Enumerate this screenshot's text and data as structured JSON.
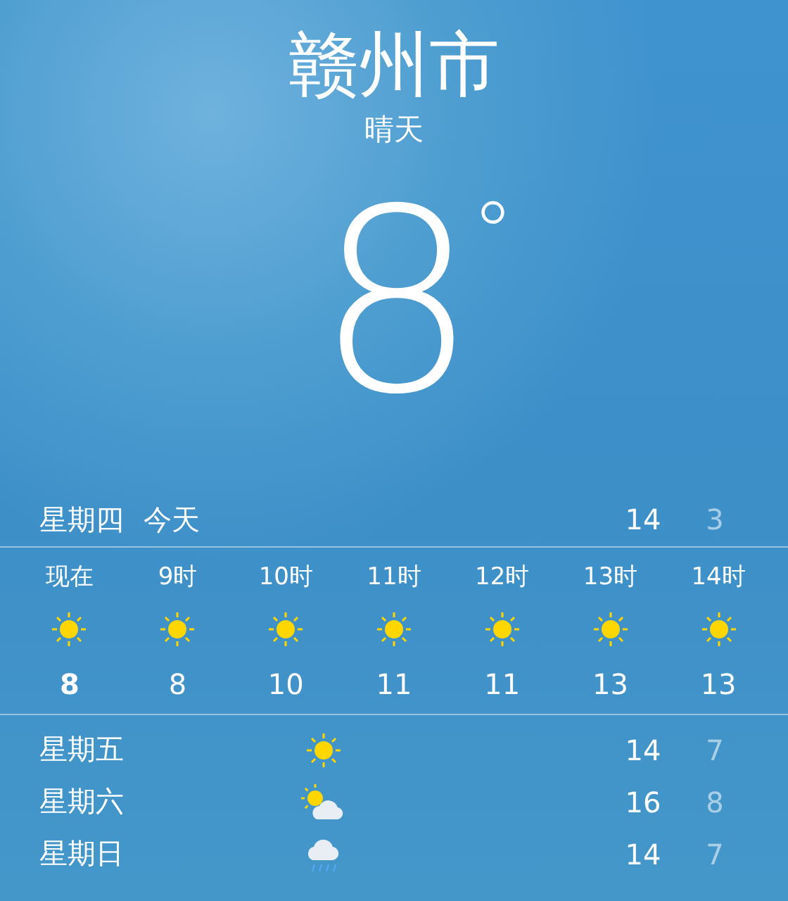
{
  "location": {
    "city": "赣州市",
    "condition": "晴天",
    "temperature": "8",
    "unit": "°"
  },
  "today": {
    "day": "星期四",
    "label": "今天",
    "high": "14",
    "low": "3"
  },
  "hourly": [
    {
      "time": "现在",
      "kind": "sunny",
      "temp": "8",
      "now": true
    },
    {
      "time": "9时",
      "kind": "sunny",
      "temp": "8",
      "now": false
    },
    {
      "time": "10时",
      "kind": "sunny",
      "temp": "10",
      "now": false
    },
    {
      "time": "11时",
      "kind": "sunny",
      "temp": "11",
      "now": false
    },
    {
      "time": "12时",
      "kind": "sunny",
      "temp": "11",
      "now": false
    },
    {
      "time": "13时",
      "kind": "sunny",
      "temp": "13",
      "now": false
    },
    {
      "time": "14时",
      "kind": "sunny",
      "temp": "13",
      "now": false
    }
  ],
  "daily": [
    {
      "day": "星期五",
      "kind": "sunny",
      "high": "14",
      "low": "7"
    },
    {
      "day": "星期六",
      "kind": "partly-cloudy",
      "high": "16",
      "low": "8"
    },
    {
      "day": "星期日",
      "kind": "rain",
      "high": "14",
      "low": "7"
    }
  ]
}
